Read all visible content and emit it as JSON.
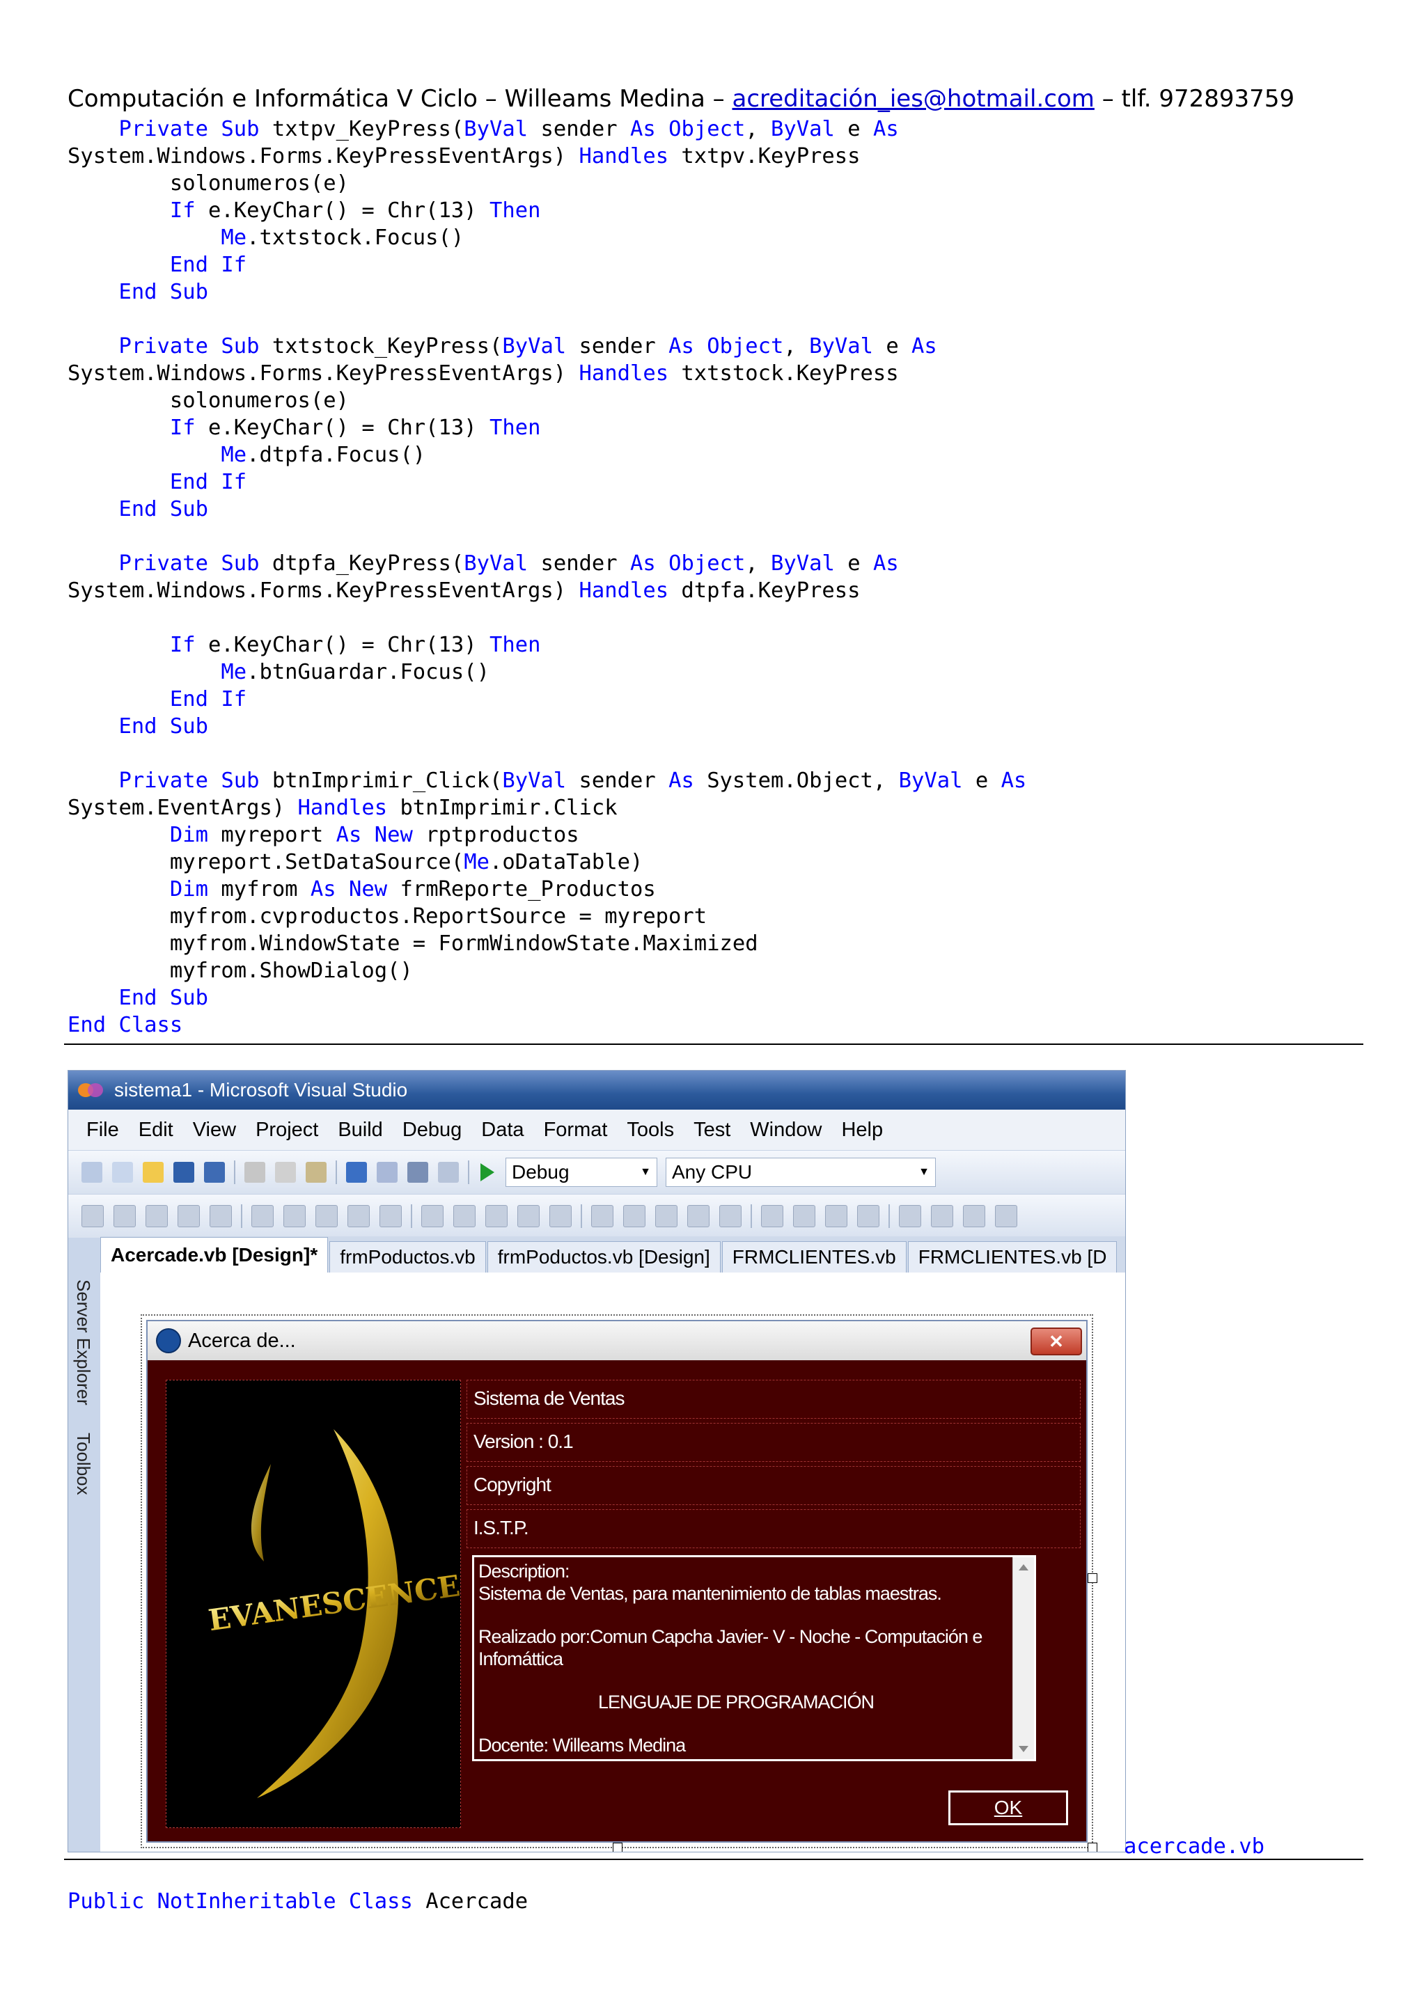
{
  "header": {
    "prefix": "Computación e Informática V Ciclo – Willeams Medina – ",
    "email": "acreditación_ies@hotmail.com",
    "suffix": " – tlf. 972893759"
  },
  "code_lines": [
    [
      {
        "t": "    "
      },
      {
        "t": "Private",
        "k": 1
      },
      {
        "t": " "
      },
      {
        "t": "Sub",
        "k": 1
      },
      {
        "t": " txtpv_KeyPress("
      },
      {
        "t": "ByVal",
        "k": 1
      },
      {
        "t": " sender "
      },
      {
        "t": "As",
        "k": 1
      },
      {
        "t": " "
      },
      {
        "t": "Object",
        "k": 1
      },
      {
        "t": ", "
      },
      {
        "t": "ByVal",
        "k": 1
      },
      {
        "t": " e "
      },
      {
        "t": "As",
        "k": 1
      }
    ],
    [
      {
        "t": "System.Windows.Forms.KeyPressEventArgs) "
      },
      {
        "t": "Handles",
        "k": 1
      },
      {
        "t": " txtpv.KeyPress"
      }
    ],
    [
      {
        "t": "        solonumeros(e)"
      }
    ],
    [
      {
        "t": "        "
      },
      {
        "t": "If",
        "k": 1
      },
      {
        "t": " e.KeyChar() = Chr(13) "
      },
      {
        "t": "Then",
        "k": 1
      }
    ],
    [
      {
        "t": "            "
      },
      {
        "t": "Me",
        "k": 1
      },
      {
        "t": ".txtstock.Focus()"
      }
    ],
    [
      {
        "t": "        "
      },
      {
        "t": "End If",
        "k": 1
      }
    ],
    [
      {
        "t": "    "
      },
      {
        "t": "End Sub",
        "k": 1
      }
    ],
    [
      {
        "t": ""
      }
    ],
    [
      {
        "t": "    "
      },
      {
        "t": "Private",
        "k": 1
      },
      {
        "t": " "
      },
      {
        "t": "Sub",
        "k": 1
      },
      {
        "t": " txtstock_KeyPress("
      },
      {
        "t": "ByVal",
        "k": 1
      },
      {
        "t": " sender "
      },
      {
        "t": "As",
        "k": 1
      },
      {
        "t": " "
      },
      {
        "t": "Object",
        "k": 1
      },
      {
        "t": ", "
      },
      {
        "t": "ByVal",
        "k": 1
      },
      {
        "t": " e "
      },
      {
        "t": "As",
        "k": 1
      }
    ],
    [
      {
        "t": "System.Windows.Forms.KeyPressEventArgs) "
      },
      {
        "t": "Handles",
        "k": 1
      },
      {
        "t": " txtstock.KeyPress"
      }
    ],
    [
      {
        "t": "        solonumeros(e)"
      }
    ],
    [
      {
        "t": "        "
      },
      {
        "t": "If",
        "k": 1
      },
      {
        "t": " e.KeyChar() = Chr(13) "
      },
      {
        "t": "Then",
        "k": 1
      }
    ],
    [
      {
        "t": "            "
      },
      {
        "t": "Me",
        "k": 1
      },
      {
        "t": ".dtpfa.Focus()"
      }
    ],
    [
      {
        "t": "        "
      },
      {
        "t": "End If",
        "k": 1
      }
    ],
    [
      {
        "t": "    "
      },
      {
        "t": "End Sub",
        "k": 1
      }
    ],
    [
      {
        "t": ""
      }
    ],
    [
      {
        "t": "    "
      },
      {
        "t": "Private",
        "k": 1
      },
      {
        "t": " "
      },
      {
        "t": "Sub",
        "k": 1
      },
      {
        "t": " dtpfa_KeyPress("
      },
      {
        "t": "ByVal",
        "k": 1
      },
      {
        "t": " sender "
      },
      {
        "t": "As",
        "k": 1
      },
      {
        "t": " "
      },
      {
        "t": "Object",
        "k": 1
      },
      {
        "t": ", "
      },
      {
        "t": "ByVal",
        "k": 1
      },
      {
        "t": " e "
      },
      {
        "t": "As",
        "k": 1
      }
    ],
    [
      {
        "t": "System.Windows.Forms.KeyPressEventArgs) "
      },
      {
        "t": "Handles",
        "k": 1
      },
      {
        "t": " dtpfa.KeyPress"
      }
    ],
    [
      {
        "t": ""
      }
    ],
    [
      {
        "t": "        "
      },
      {
        "t": "If",
        "k": 1
      },
      {
        "t": " e.KeyChar() = Chr(13) "
      },
      {
        "t": "Then",
        "k": 1
      }
    ],
    [
      {
        "t": "            "
      },
      {
        "t": "Me",
        "k": 1
      },
      {
        "t": ".btnGuardar.Focus()"
      }
    ],
    [
      {
        "t": "        "
      },
      {
        "t": "End If",
        "k": 1
      }
    ],
    [
      {
        "t": "    "
      },
      {
        "t": "End Sub",
        "k": 1
      }
    ],
    [
      {
        "t": ""
      }
    ],
    [
      {
        "t": "    "
      },
      {
        "t": "Private",
        "k": 1
      },
      {
        "t": " "
      },
      {
        "t": "Sub",
        "k": 1
      },
      {
        "t": " btnImprimir_Click("
      },
      {
        "t": "ByVal",
        "k": 1
      },
      {
        "t": " sender "
      },
      {
        "t": "As",
        "k": 1
      },
      {
        "t": " System.Object, "
      },
      {
        "t": "ByVal",
        "k": 1
      },
      {
        "t": " e "
      },
      {
        "t": "As",
        "k": 1
      }
    ],
    [
      {
        "t": "System.EventArgs) "
      },
      {
        "t": "Handles",
        "k": 1
      },
      {
        "t": " btnImprimir.Click"
      }
    ],
    [
      {
        "t": "        "
      },
      {
        "t": "Dim",
        "k": 1
      },
      {
        "t": " myreport "
      },
      {
        "t": "As",
        "k": 1
      },
      {
        "t": " "
      },
      {
        "t": "New",
        "k": 1
      },
      {
        "t": " rptproductos"
      }
    ],
    [
      {
        "t": "        myreport.SetDataSource("
      },
      {
        "t": "Me",
        "k": 1
      },
      {
        "t": ".oDataTable)"
      }
    ],
    [
      {
        "t": "        "
      },
      {
        "t": "Dim",
        "k": 1
      },
      {
        "t": " myfrom "
      },
      {
        "t": "As",
        "k": 1
      },
      {
        "t": " "
      },
      {
        "t": "New",
        "k": 1
      },
      {
        "t": " frmReporte_Productos"
      }
    ],
    [
      {
        "t": "        myfrom.cvproductos.ReportSource = myreport"
      }
    ],
    [
      {
        "t": "        myfrom.WindowState = FormWindowState.Maximized"
      }
    ],
    [
      {
        "t": "        myfrom.ShowDialog()"
      }
    ],
    [
      {
        "t": "    "
      },
      {
        "t": "End Sub",
        "k": 1
      }
    ],
    [
      {
        "t": "End Class",
        "k": 1
      }
    ]
  ],
  "vs": {
    "window_title": "sistema1 - Microsoft Visual Studio",
    "menu": [
      "File",
      "Edit",
      "View",
      "Project",
      "Build",
      "Debug",
      "Data",
      "Format",
      "Tools",
      "Test",
      "Window",
      "Help"
    ],
    "config": "Debug",
    "platform": "Any CPU",
    "side_tabs": [
      "Server Explorer",
      "Toolbox"
    ],
    "tabs": [
      "Acercade.vb [Design]*",
      "frmPoductos.vb",
      "frmPoductos.vb [Design]",
      "FRMCLIENTES.vb",
      "FRMCLIENTES.vb [D"
    ],
    "active_tab": 0
  },
  "about_form": {
    "title": "Acerca de...",
    "close": "✕",
    "labels": [
      "Sistema de Ventas",
      "Version : 0.1",
      "Copyright",
      "I.S.T.P."
    ],
    "desc_heading": "Description:",
    "desc_line1": "Sistema de Ventas, para mantenimiento de tablas maestras.",
    "desc_line2": "Realizado por:Comun Capcha Javier- V - Noche - Computación e Infomáttica",
    "desc_line3": "LENGUAJE DE PROGRAMACIÓN",
    "desc_line4": "Docente:  Willeams Medina",
    "ok": "OK",
    "logo_text": "EVANESCENCE"
  },
  "caption": "acercade.vb",
  "final_code": [
    {
      "t": "Public",
      "k": 1
    },
    {
      "t": " "
    },
    {
      "t": "NotInheritable",
      "k": 1
    },
    {
      "t": " "
    },
    {
      "t": "Class",
      "k": 1
    },
    {
      "t": " Acercade"
    }
  ],
  "colors": {
    "keyword": "#0000ff",
    "form_bg": "#460000",
    "link": "#0000cc"
  }
}
